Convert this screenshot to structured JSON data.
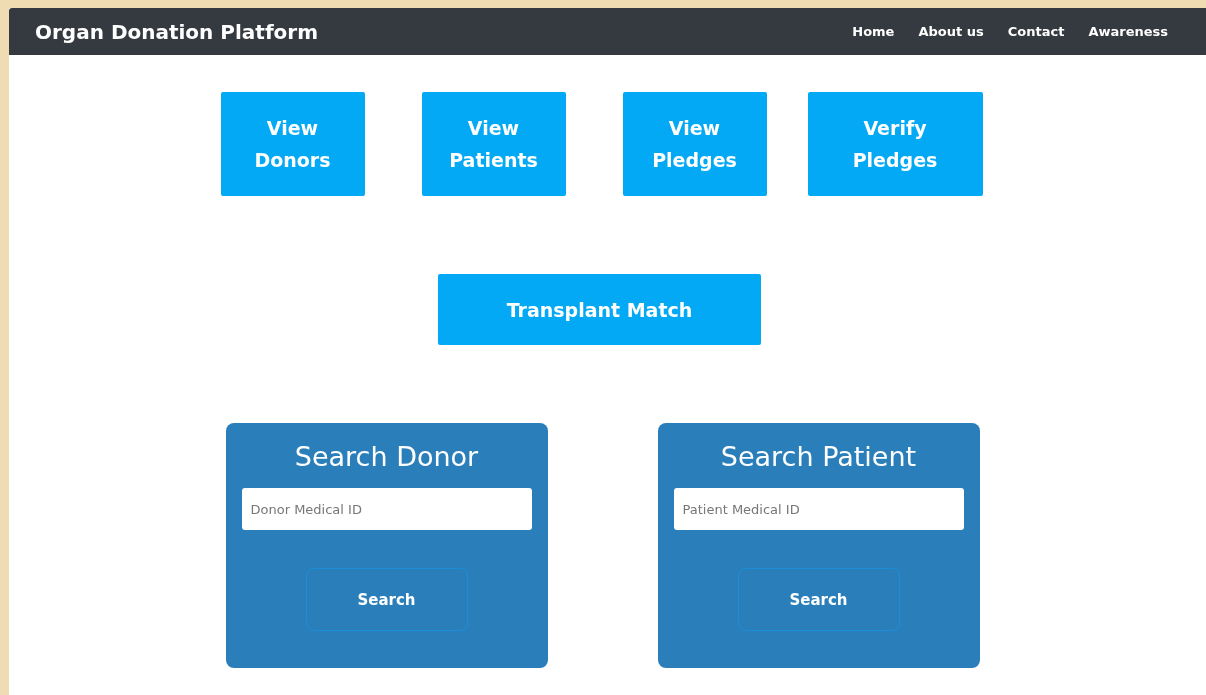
{
  "navbar": {
    "brand": "Organ Donation Platform",
    "links": [
      "Home",
      "About us",
      "Contact",
      "Awareness"
    ]
  },
  "actions": [
    {
      "label": "View\nDonors"
    },
    {
      "label": "View\nPatients"
    },
    {
      "label": "View\nPledges"
    },
    {
      "label": "Verify\nPledges"
    }
  ],
  "transplant_button": "Transplant Match",
  "search_cards": [
    {
      "title": "Search Donor",
      "placeholder": "Donor Medical ID",
      "button": "Search"
    },
    {
      "title": "Search Patient",
      "placeholder": "Patient Medical ID",
      "button": "Search"
    }
  ]
}
